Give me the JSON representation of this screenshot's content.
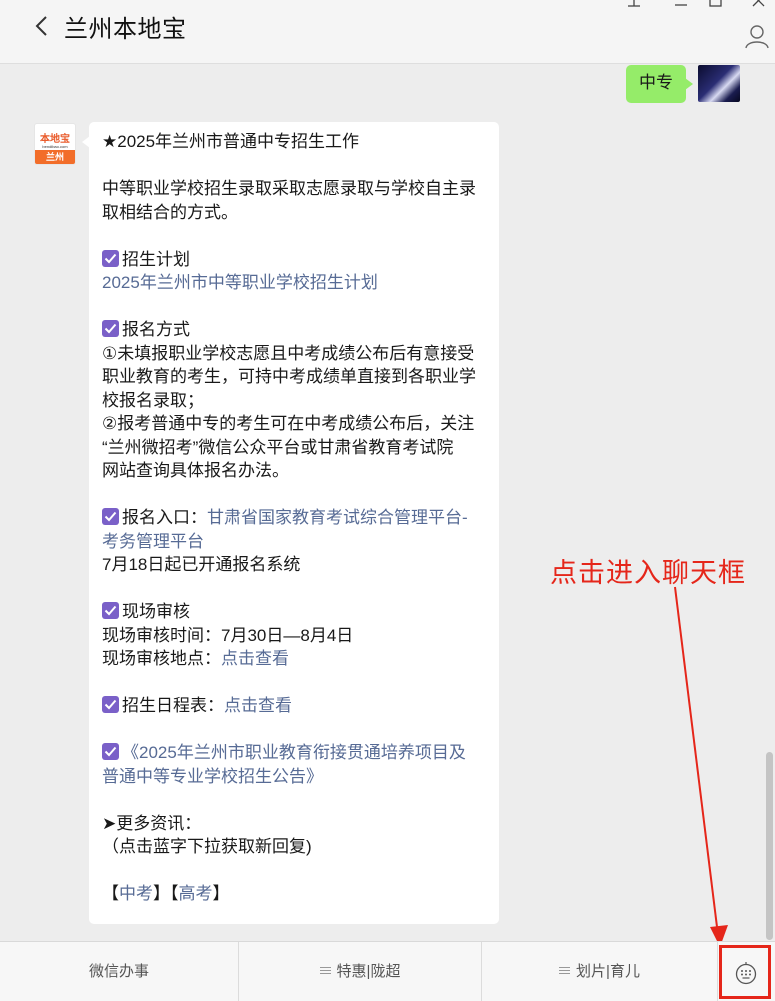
{
  "header": {
    "title": "兰州本地宝"
  },
  "messages": {
    "outgoing": {
      "text": "中专"
    },
    "bot_logo": {
      "top": "本地宝",
      "url": "bendibao.com",
      "city": "兰州"
    },
    "lines": [
      {
        "t": "★2025年兰州市普通中专招生工作"
      },
      {
        "t": ""
      },
      {
        "t": "中等职业学校招生录取采取志愿录取与学校自主录"
      },
      {
        "t": "取相结合的方式。"
      },
      {
        "t": ""
      },
      {
        "check": true,
        "t": "招生计划"
      },
      {
        "link": "2025年兰州市中等职业学校招生计划"
      },
      {
        "t": ""
      },
      {
        "check": true,
        "t": "报名方式"
      },
      {
        "t": "①未填报职业学校志愿且中考成绩公布后有意接受"
      },
      {
        "t": "职业教育的考生，可持中考成绩单直接到各职业学"
      },
      {
        "t": "校报名录取；"
      },
      {
        "t": "②报考普通中专的考生可在中考成绩公布后，关注"
      },
      {
        "t": "“兰州微招考”微信公众平台或甘肃省教育考试院"
      },
      {
        "t": "网站查询具体报名办法。"
      },
      {
        "t": ""
      },
      {
        "check": true,
        "t": "报名入口：",
        "link": "甘肃省国家教育考试综合管理平台-"
      },
      {
        "link": "考务管理平台"
      },
      {
        "t": "7月18日起已开通报名系统"
      },
      {
        "t": ""
      },
      {
        "check": true,
        "t": "现场审核"
      },
      {
        "t": "现场审核时间：7月30日—8月4日"
      },
      {
        "t": "现场审核地点：",
        "link": "点击查看"
      },
      {
        "t": ""
      },
      {
        "check": true,
        "t": "招生日程表：",
        "link": "点击查看"
      },
      {
        "t": ""
      },
      {
        "check": true,
        "link": "《2025年兰州市职业教育衔接贯通培养项目及"
      },
      {
        "link": "普通中等专业学校招生公告》"
      },
      {
        "t": ""
      },
      {
        "t": "➤更多资讯："
      },
      {
        "t": "（点击蓝字下拉获取新回复)"
      },
      {
        "t": ""
      },
      {
        "t": "【",
        "link": "中考",
        "t2": "】【",
        "link2": "高考",
        "t3": "】"
      }
    ]
  },
  "annotation": {
    "text": "点击进入聊天框",
    "color": "#e5261a"
  },
  "menu": {
    "items": [
      {
        "label": "微信办事",
        "has_icon": false
      },
      {
        "label": "特惠|陇超",
        "has_icon": true
      },
      {
        "label": "划片|育儿",
        "has_icon": true
      }
    ]
  },
  "colors": {
    "link": "#576b95",
    "check": "#7a60c8",
    "outgoing_bubble": "#95ec69"
  },
  "icons": [
    "chevron-left-icon",
    "pin-icon",
    "minimize-icon",
    "maximize-icon",
    "close-icon",
    "profile-icon",
    "keyboard-icon",
    "checkbox-icon",
    "menu-lines-icon"
  ]
}
